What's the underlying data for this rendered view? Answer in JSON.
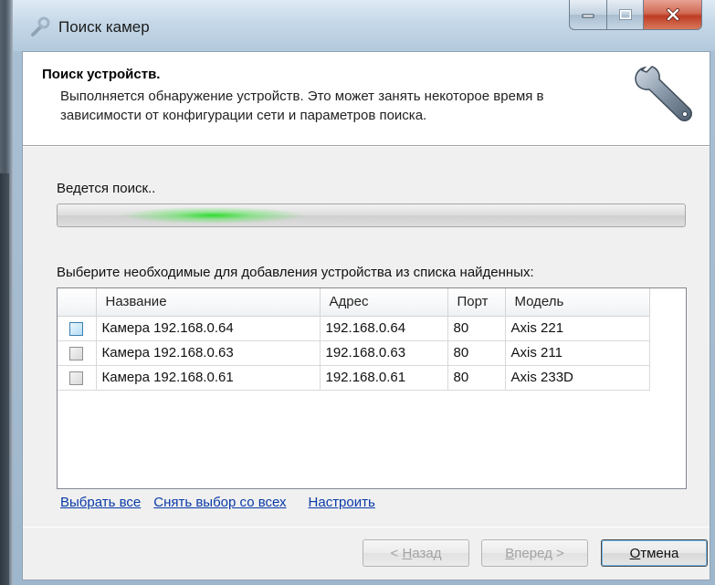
{
  "window": {
    "title": "Поиск камер",
    "icon": "wrench-icon"
  },
  "header": {
    "title": "Поиск устройств.",
    "subtitle": "Выполняется обнаружение устройств. Это может занять некоторое время в зависимости от конфигурации сети и параметров поиска."
  },
  "status": {
    "text": "Ведется поиск..",
    "progress_style": "marquee",
    "accent_color": "#28dc28"
  },
  "instruction": "Выберите необходимые для добавления устройства из списка найденных:",
  "table": {
    "columns": [
      "Название",
      "Адрес",
      "Порт",
      "Модель"
    ],
    "rows": [
      {
        "name": "Камера 192.168.0.64",
        "address": "192.168.0.64",
        "port": "80",
        "model": "Axis 221",
        "checked": false
      },
      {
        "name": "Камера 192.168.0.63",
        "address": "192.168.0.63",
        "port": "80",
        "model": "Axis 211",
        "checked": false
      },
      {
        "name": "Камера 192.168.0.61",
        "address": "192.168.0.61",
        "port": "80",
        "model": "Axis 233D",
        "checked": false
      }
    ]
  },
  "links": {
    "select_all": "Выбрать все",
    "deselect_all": "Снять выбор со всех",
    "configure": "Настроить"
  },
  "buttons": {
    "back": {
      "prefix": "< ",
      "accel": "Н",
      "rest": "азад",
      "enabled": false
    },
    "next": {
      "accel": "В",
      "rest": "перед",
      "suffix": " >",
      "enabled": false
    },
    "cancel": {
      "accel": "О",
      "rest": "тмена",
      "enabled": true
    }
  }
}
